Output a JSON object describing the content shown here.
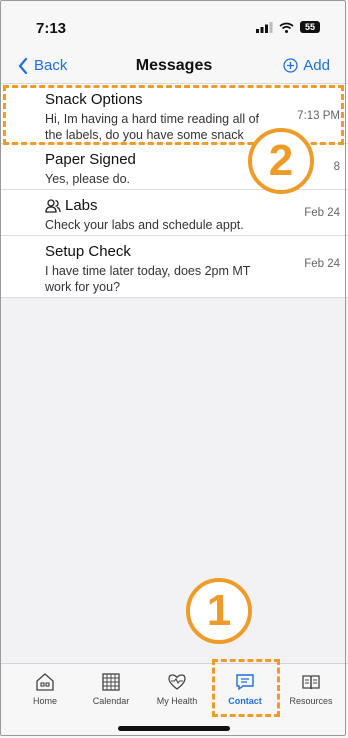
{
  "status": {
    "time": "7:13",
    "battery": "55"
  },
  "nav": {
    "back_label": "Back",
    "title": "Messages",
    "add_label": "Add"
  },
  "messages": [
    {
      "title": "Snack Options",
      "preview": "Hi, Im having a hard time reading all of the labels, do you have some snack options?",
      "time": "7:13 PM",
      "icon": ""
    },
    {
      "title": "Paper Signed",
      "preview": "Yes, please do.",
      "time": "8",
      "icon": ""
    },
    {
      "title": "Labs",
      "preview": "Check your labs and schedule appt.",
      "time": "Feb 24",
      "icon": "lab-users-icon"
    },
    {
      "title": "Setup Check",
      "preview": "I have time later today, does 2pm MT work for you?",
      "time": "Feb 24",
      "icon": ""
    }
  ],
  "tabs": [
    {
      "label": "Home",
      "icon": "home-icon"
    },
    {
      "label": "Calendar",
      "icon": "calendar-icon"
    },
    {
      "label": "My Health",
      "icon": "heart-pulse-icon"
    },
    {
      "label": "Contact",
      "icon": "chat-icon",
      "active": true
    },
    {
      "label": "Resources",
      "icon": "book-icon"
    }
  ],
  "callouts": {
    "one": "1",
    "two": "2"
  },
  "colors": {
    "accent": "#1f6fd6",
    "highlight": "#ef9b2a"
  }
}
